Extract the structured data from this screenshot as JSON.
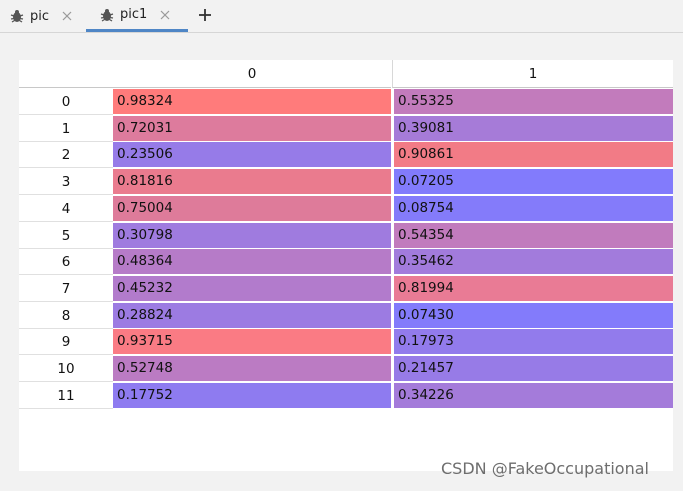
{
  "tabs": [
    {
      "label": "pic",
      "icon": "bug-icon",
      "active": false
    },
    {
      "label": "pic1",
      "icon": "bug-icon",
      "active": true
    }
  ],
  "table": {
    "columns": [
      "0",
      "1"
    ],
    "rows": [
      {
        "index": "0",
        "values": [
          "0.98324",
          "0.55325"
        ],
        "colors": [
          "#ff7b7b",
          "#c27bbc"
        ]
      },
      {
        "index": "1",
        "values": [
          "0.72031",
          "0.39081"
        ],
        "colors": [
          "#dd7b9d",
          "#a67bd8"
        ]
      },
      {
        "index": "2",
        "values": [
          "0.23506",
          "0.90861"
        ],
        "colors": [
          "#967be8",
          "#f27b86"
        ]
      },
      {
        "index": "3",
        "values": [
          "0.81816",
          "0.07205"
        ],
        "colors": [
          "#ea7b8e",
          "#827bfc"
        ]
      },
      {
        "index": "4",
        "values": [
          "0.75004",
          "0.08754"
        ],
        "colors": [
          "#de7b9a",
          "#847bfa"
        ]
      },
      {
        "index": "5",
        "values": [
          "0.30798",
          "0.54354"
        ],
        "colors": [
          "#9f7bdf",
          "#c17bbd"
        ]
      },
      {
        "index": "6",
        "values": [
          "0.48364",
          "0.35462"
        ],
        "colors": [
          "#b67bc8",
          "#a27bdc"
        ]
      },
      {
        "index": "7",
        "values": [
          "0.45232",
          "0.81994"
        ],
        "colors": [
          "#b27bcc",
          "#e97b95"
        ]
      },
      {
        "index": "8",
        "values": [
          "0.28824",
          "0.07430"
        ],
        "colors": [
          "#9c7be2",
          "#837bfb"
        ]
      },
      {
        "index": "9",
        "values": [
          "0.93715",
          "0.17973"
        ],
        "colors": [
          "#fa7b84",
          "#927bec"
        ]
      },
      {
        "index": "10",
        "values": [
          "0.52748",
          "0.21457"
        ],
        "colors": [
          "#bb7bc3",
          "#977be7"
        ]
      },
      {
        "index": "11",
        "values": [
          "0.17752",
          "0.34226"
        ],
        "colors": [
          "#8e7bf0",
          "#a47bda"
        ]
      }
    ]
  },
  "watermark": "CSDN @FakeOccupational"
}
